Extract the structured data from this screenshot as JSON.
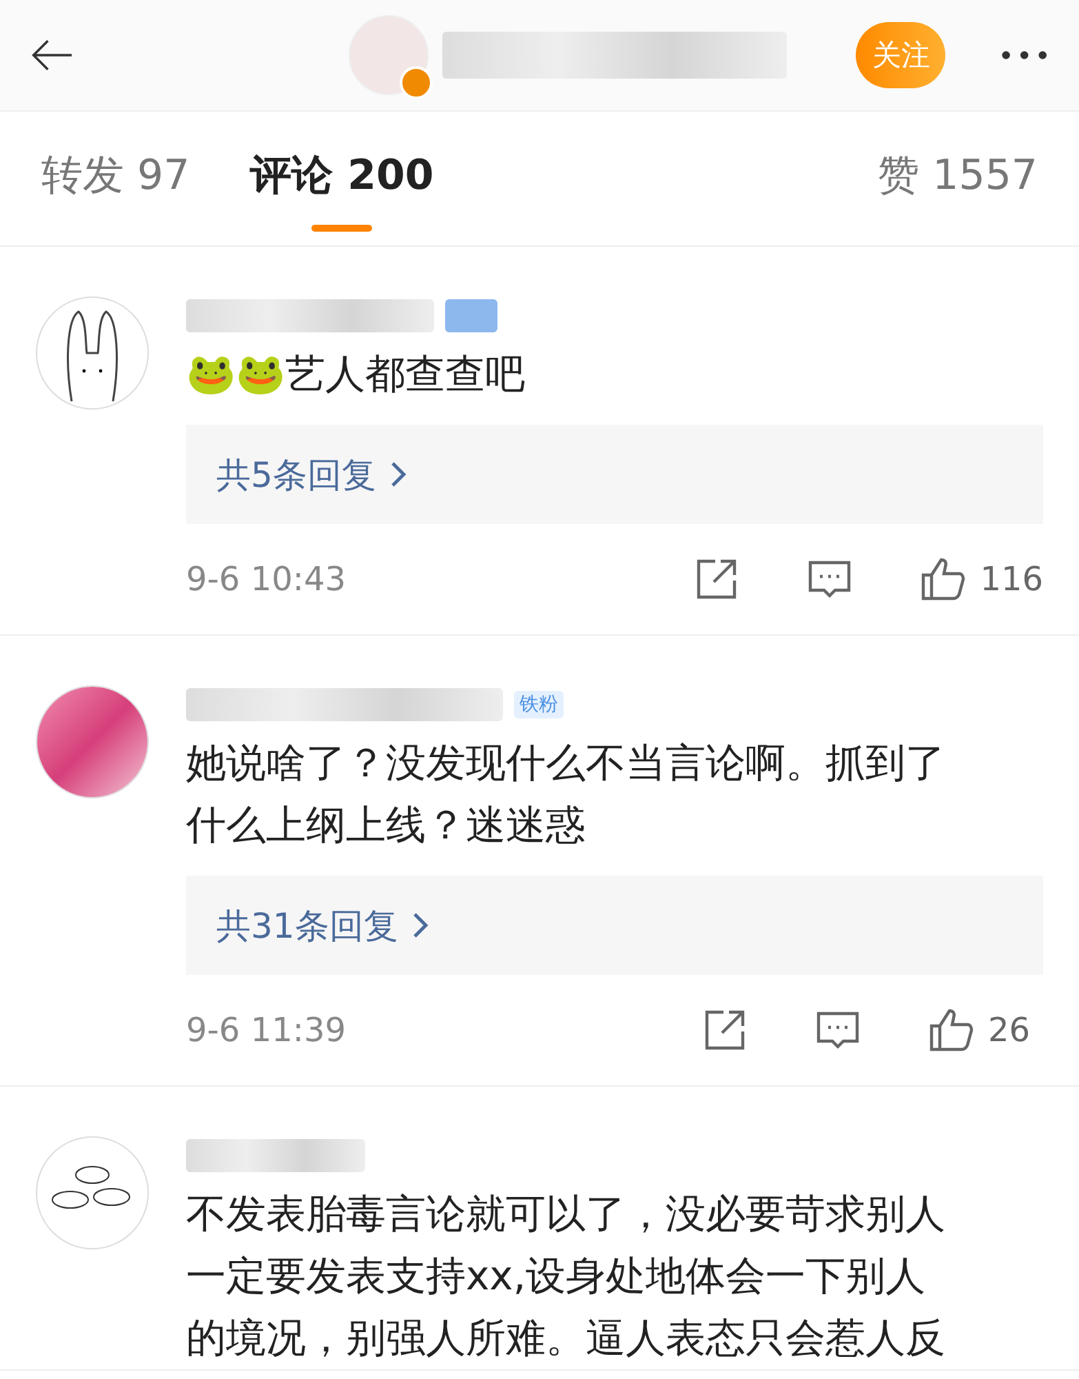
{
  "header": {
    "follow_label": "关注",
    "verified": true
  },
  "tabs": [
    {
      "label": "转发 97",
      "selected": false
    },
    {
      "label": "评论 200",
      "selected": true
    },
    {
      "label": "赞 1557",
      "selected": false
    }
  ],
  "comments": [
    {
      "kind": "rabbit",
      "lines": [
        "🐸🐸艺人都查查吧"
      ],
      "replies": "共5条回复",
      "time": "9-6 10:43",
      "likes": "116"
    },
    {
      "kind": "photo",
      "badge": "铁粉",
      "lines": [
        "她说啥了？没发现什么不当言论啊。抓到了",
        "什么上纲上线？迷迷惑"
      ],
      "replies": "共31条回复",
      "time": "9-6 11:39",
      "likes": "26"
    },
    {
      "kind": "bowls",
      "lines": [
        "不发表胎毒言论就可以了，没必要苛求别人",
        "一定要发表支持xx,设身处地体会一下别人",
        "的境况，别强人所难。逼人表态只会惹人反"
      ]
    }
  ]
}
